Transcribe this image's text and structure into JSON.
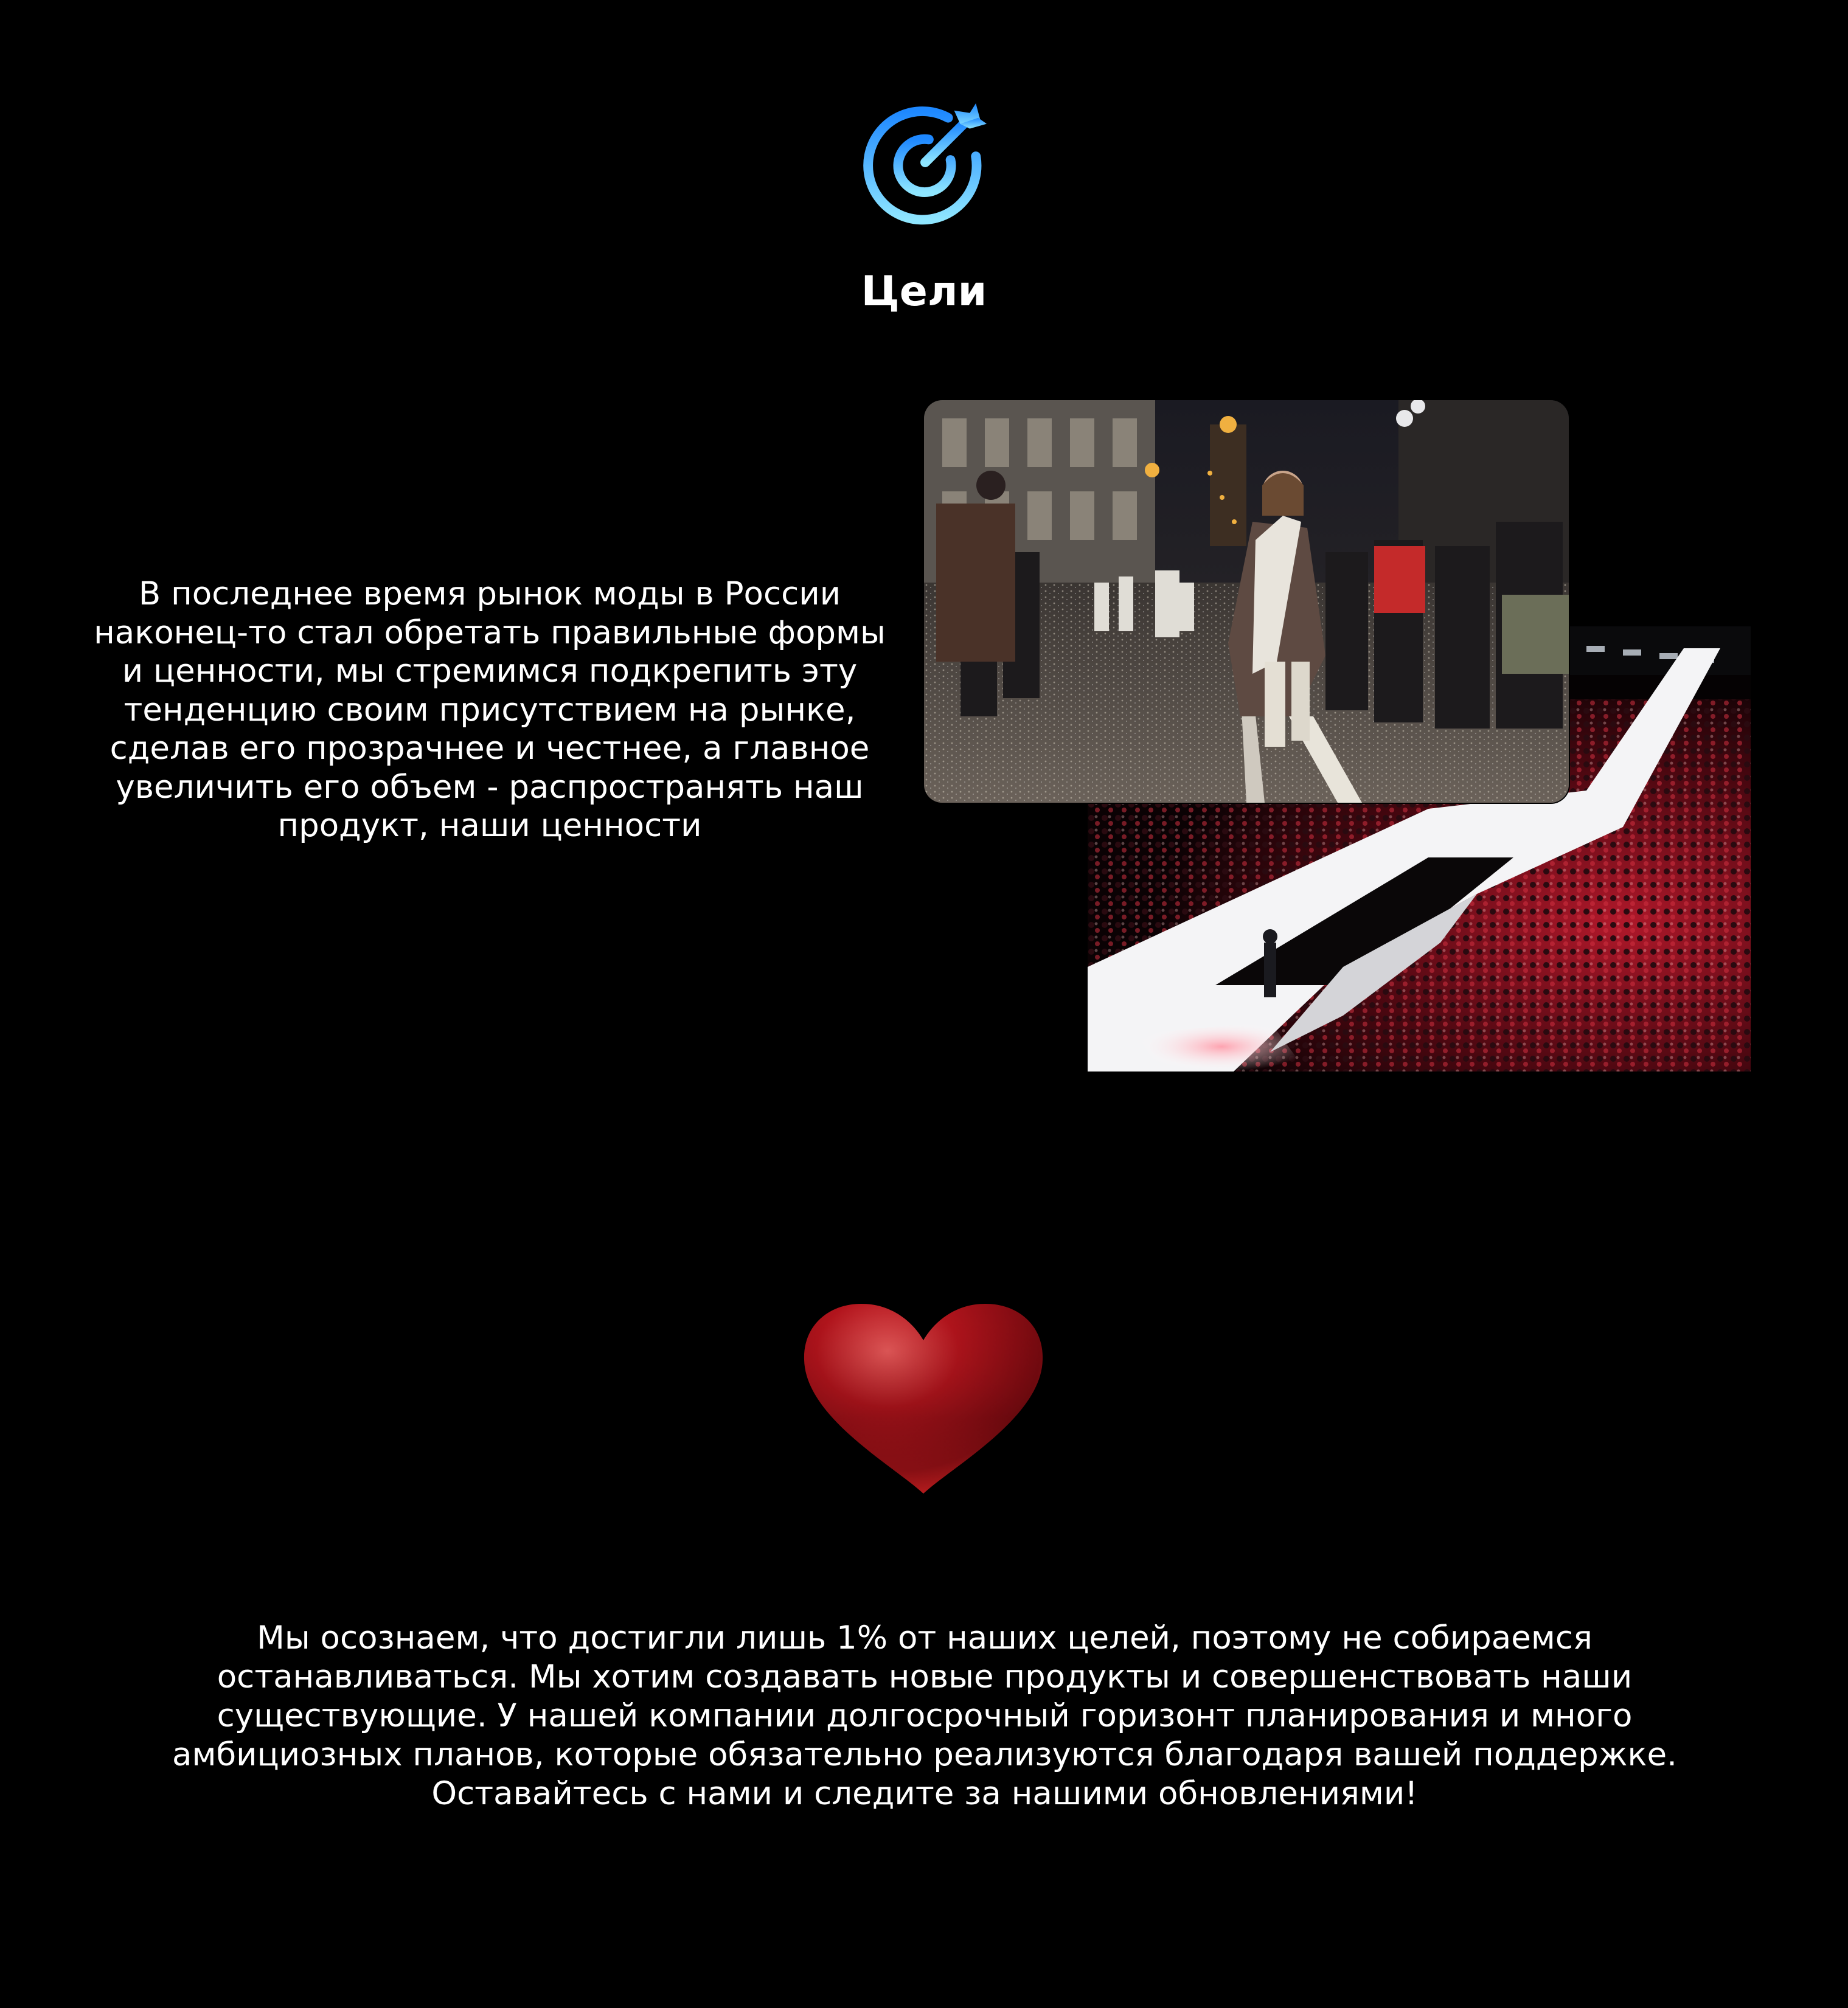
{
  "header": {
    "icon": "target-arrow-icon",
    "title": "Цели",
    "icon_gradient": [
      "#1e88ff",
      "#7fe0ff"
    ]
  },
  "intro": {
    "text": "В последнее время рынок моды в России наконец-то стал обретать правильные формы и ценности, мы стремимся подкрепить эту тенденцию своим присутствием на рынке, сделав его прозрачнее и честнее, а главное увеличить его объем - распространять наш продукт, наши ценности"
  },
  "photos": [
    {
      "name": "street-fashion-show-photo"
    },
    {
      "name": "runway-show-photo"
    }
  ],
  "heart": {
    "icon": "heart-icon",
    "color": "#b3141c"
  },
  "closing": {
    "text": "Мы осознаем, что достигли лишь 1% от наших целей, поэтому не собираемся останавливаться. Мы хотим создавать новые продукты и совершенствовать наши существующие. У нашей компании долгосрочный горизонт планирования и много амбициозных планов, которые обязательно реализуются благодаря вашей поддержке. Оставайтесь с нами и следите за нашими обновлениями!"
  },
  "colors": {
    "background": "#000000",
    "text": "#ffffff"
  }
}
